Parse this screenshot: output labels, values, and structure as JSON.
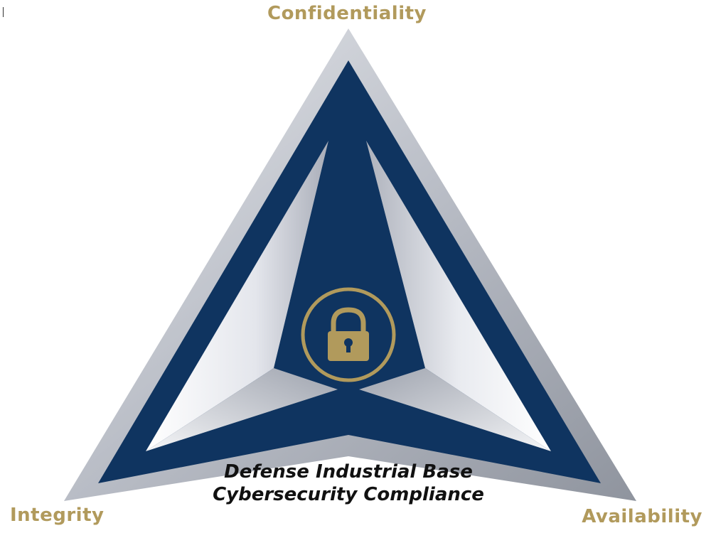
{
  "labels": {
    "top": "Confidentiality",
    "left": "Integrity",
    "right": "Availability"
  },
  "caption": {
    "line1": "Defense Industrial Base",
    "line2": "Cybersecurity Compliance"
  },
  "icons": {
    "center": "padlock-icon"
  },
  "colors": {
    "gold": "#b19a5c",
    "navy": "#0f3460",
    "silver": "#c9ccd3",
    "text": "#111111"
  }
}
